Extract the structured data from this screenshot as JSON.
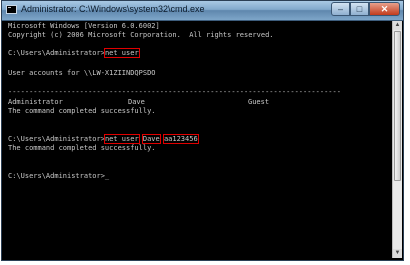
{
  "window": {
    "title": "Administrator: C:\\Windows\\system32\\cmd.exe",
    "controls": {
      "minimize": "–",
      "maximize": "□",
      "close": "✕"
    }
  },
  "console": {
    "banner1": "Microsoft Windows [Version 6.0.6002]",
    "banner2": "Copyright (c) 2006 Microsoft Corporation.  All rights reserved.",
    "prompt": "C:\\Users\\Administrator>",
    "cmd1": "net user",
    "accounts_header": "User accounts for \\\\LW-X1ZIINDQPSDO",
    "separator": "-------------------------------------------------------------------------------",
    "user_admin": "Administrator",
    "user_dave": "Dave",
    "user_guest": "Guest",
    "completed": "The command completed successfully.",
    "cmd2_netuser": "net user",
    "cmd2_user": "Dave",
    "cmd2_password": "aa123456",
    "final_prompt": "C:\\Users\\Administrator>_"
  },
  "colors": {
    "console_bg": "#000000",
    "console_text": "#c8c8c8",
    "highlight_box": "#e00000"
  }
}
